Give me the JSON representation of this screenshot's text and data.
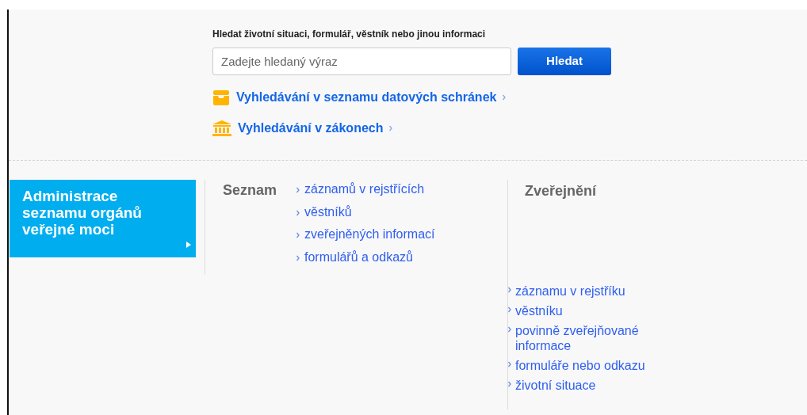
{
  "search": {
    "label": "Hledat životní situaci, formulář, věstník nebo jinou informaci",
    "placeholder": "Zadejte hledaný výraz",
    "button": "Hledat"
  },
  "quick_links": [
    {
      "kind": "tray",
      "label": "Vyhledávání v seznamu datových schránek"
    },
    {
      "kind": "building",
      "label": "Vyhledávání v zákonech"
    }
  ],
  "admin_tile": {
    "title": "Administrace seznamu orgánů veřejné moci"
  },
  "seznam": {
    "heading": "Seznam",
    "links": [
      "záznamů v rejstřících",
      "věstníků",
      "zveřejněných informací",
      "formulářů a odkazů"
    ]
  },
  "zverejneni": {
    "heading": "Zveřejnění",
    "links": [
      "záznamu v rejstříku",
      "věstníku",
      "povinně zveřejňované informace",
      "formuláře nebo odkazu",
      "životní situace"
    ]
  }
}
